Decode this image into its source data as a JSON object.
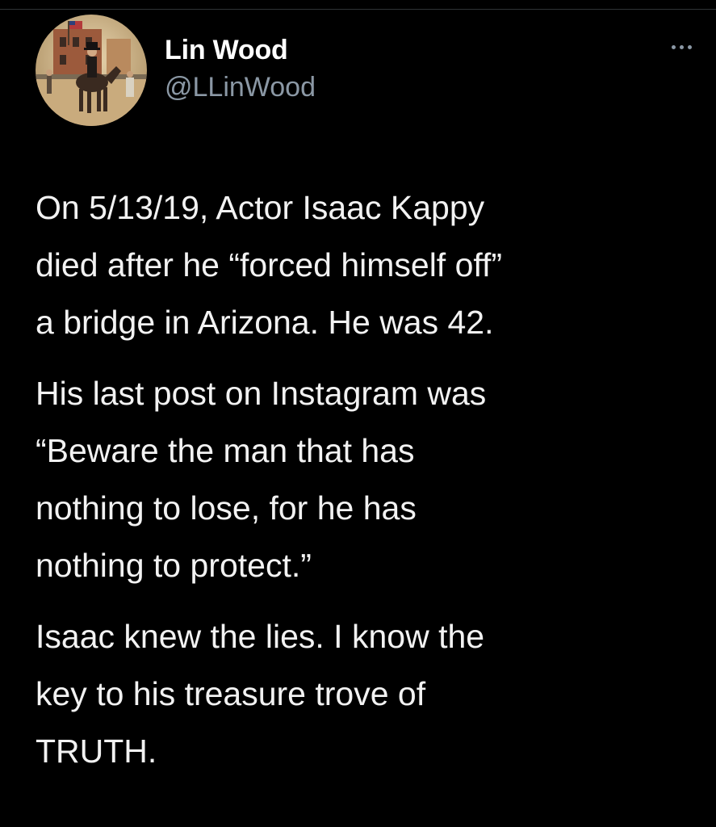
{
  "tweet": {
    "author": {
      "display_name": "Lin Wood",
      "handle": "@LLinWood",
      "avatar_icon": "avatar-painting-horse-rider"
    },
    "more_icon": "more-options-icon",
    "paragraphs": [
      {
        "lines": [
          "On 5/13/19, Actor Isaac Kappy",
          "died after he “forced himself off”",
          "a bridge in Arizona. He was 42."
        ]
      },
      {
        "lines": [
          "His last post on Instagram was",
          "“Beware the man that has",
          "nothing to lose, for he has",
          "nothing to protect.”"
        ]
      },
      {
        "lines": [
          "Isaac knew the lies. I know the",
          "key to his treasure trove of",
          "TRUTH."
        ]
      }
    ]
  },
  "colors": {
    "background": "#000000",
    "name": "#ffffff",
    "handle": "#8b98a5",
    "body_text": "#f2f2f2"
  }
}
